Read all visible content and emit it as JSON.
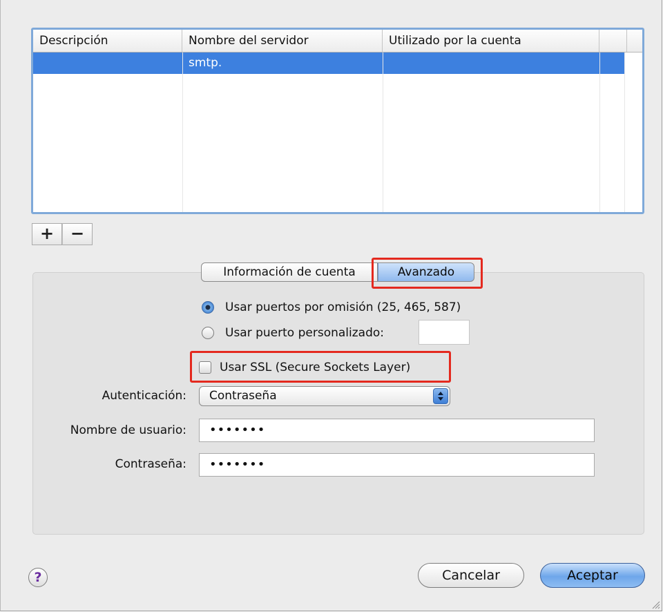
{
  "table": {
    "columns": [
      "Descripción",
      "Nombre del servidor",
      "Utilizado por la cuenta",
      "",
      ""
    ],
    "rows": [
      {
        "description": "",
        "server": "smtp.",
        "account": "",
        "selected": true
      }
    ]
  },
  "list_buttons": {
    "add": "+",
    "remove": "−"
  },
  "tabs": [
    {
      "label": "Información de cuenta",
      "selected": false
    },
    {
      "label": "Avanzado",
      "selected": true
    }
  ],
  "advanced": {
    "port_options": [
      {
        "label": "Usar puertos por omisión (25, 465, 587)",
        "selected": true
      },
      {
        "label": "Usar puerto personalizado:",
        "selected": false
      }
    ],
    "custom_port_value": "",
    "ssl": {
      "label": "Usar SSL (Secure Sockets Layer)",
      "checked": false
    },
    "authentication": {
      "label": "Autenticación:",
      "value": "Contraseña"
    },
    "username": {
      "label": "Nombre de usuario:",
      "value": "•••••••"
    },
    "password": {
      "label": "Contraseña:",
      "value": "•••••••"
    }
  },
  "footer": {
    "help": "?",
    "cancel": "Cancelar",
    "ok": "Aceptar"
  },
  "colors": {
    "selection": "#3d80df",
    "focus_ring": "#7fa9d9",
    "highlight_box": "#e4291e",
    "default_button": "#6ea6ea"
  }
}
